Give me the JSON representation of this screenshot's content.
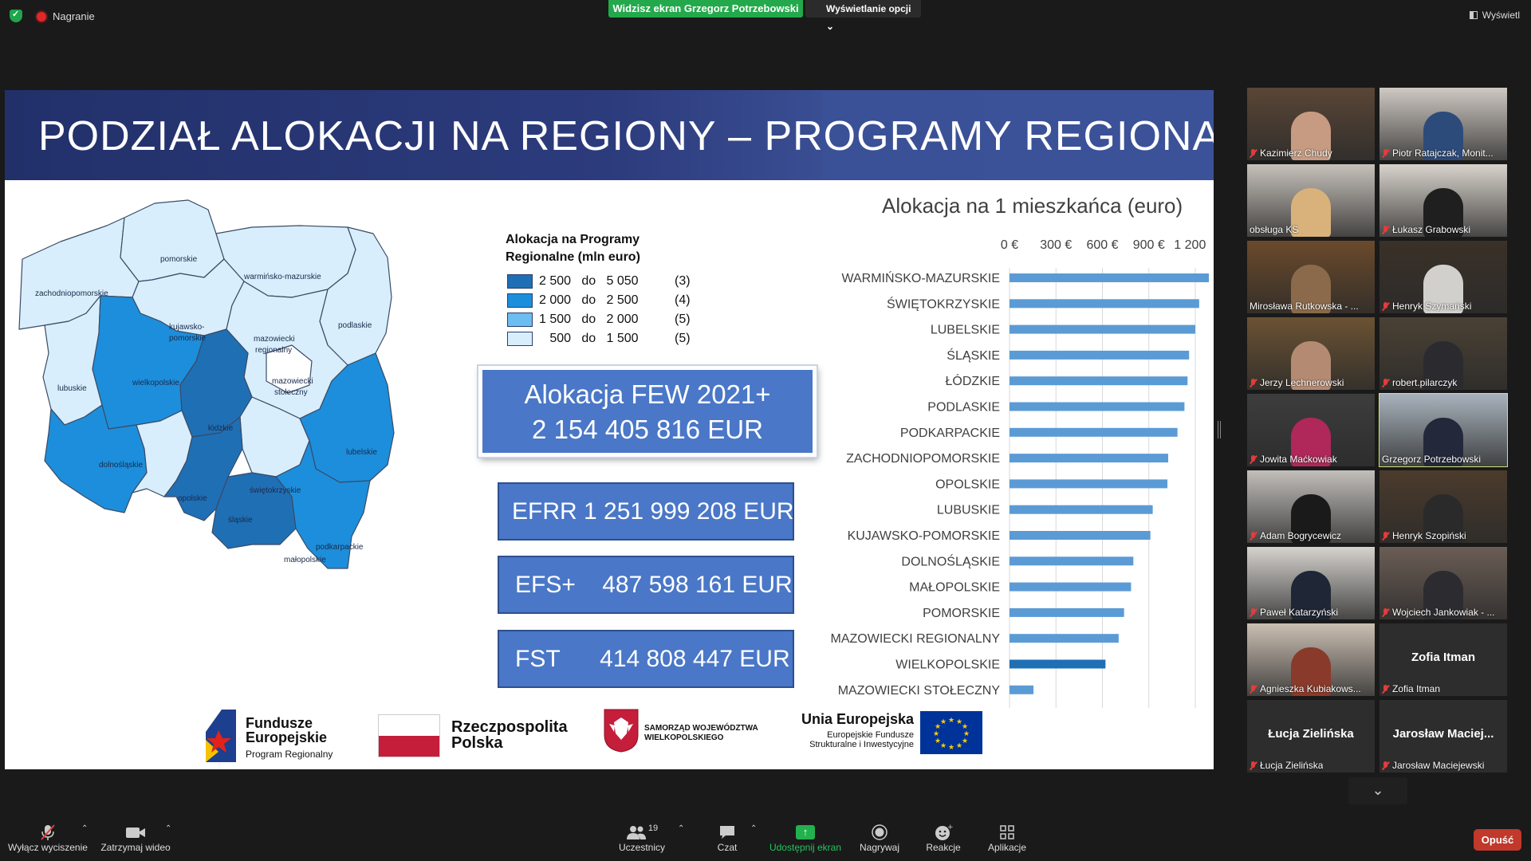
{
  "top": {
    "recording": "Nagranie",
    "share_banner": "Widzisz ekran Grzegorz Potrzebowski",
    "view_options": "Wyświetlanie opcji ⌄",
    "view_button": "Wyświetl"
  },
  "slide": {
    "title": "PODZIAŁ ALOKACJI NA REGIONY – PROGRAMY REGIONALNE",
    "legend_title_1": "Alokacja na Programy",
    "legend_title_2": "Regionalne (mln euro)",
    "legend": [
      {
        "text": "2 500   do   5 050",
        "count": "(3)",
        "color": "#1f6fb5"
      },
      {
        "text": "2 000   do   2 500",
        "count": "(4)",
        "color": "#1d8edb"
      },
      {
        "text": "1 500   do   2 000",
        "count": "(5)",
        "color": "#6dbdf0"
      },
      {
        "text": "   500   do   1 500",
        "count": "(5)",
        "color": "#d8eefc"
      }
    ],
    "regions": {
      "pomorskie": "pomorskie",
      "zachodniopomorskie": "zachodniopomorskie",
      "warminsko": "warmińsko-mazurskie",
      "podlaskie": "podlaskie",
      "kujawsko1": "kujawsko-",
      "kujawsko2": "pomorskie",
      "mazreg1": "mazowiecki",
      "mazreg2": "regionalny",
      "lubuskie": "lubuskie",
      "wielkopolskie": "wielkopolskie",
      "mazst1": "mazowiecki",
      "mazst2": "stołeczny",
      "lodzkie": "łódzkie",
      "lubelskie": "lubelskie",
      "dolnoslaskie": "dolnośląskie",
      "swietokrzyskie": "świętokrzyskie",
      "opolskie": "opolskie",
      "slaskie": "śląskie",
      "podkarpackie": "podkarpackie",
      "malopolskie": "małopolskie"
    },
    "few_line1": "Alokacja FEW 2021+",
    "few_line2": "2 154 405 816 EUR",
    "efrr": "EFRR 1 251 999 208 EUR",
    "efs": "EFS+    487 598 161 EUR",
    "fst": "FST      414 808 447 EUR",
    "logos": {
      "fe1": "Fundusze",
      "fe2": "Europejskie",
      "fe3": "Program Regionalny",
      "rp1": "Rzeczpospolita",
      "rp2": "Polska",
      "wlkp1": "SAMORZĄD WOJEWÓDZTWA",
      "wlkp2": "WIELKOPOLSKIEGO",
      "ue1": "Unia Europejska",
      "ue2": "Europejskie Fundusze",
      "ue3": "Strukturalne i Inwestycyjne"
    }
  },
  "chart_data": {
    "type": "bar",
    "orientation": "horizontal",
    "title": "Alokacja na 1 mieszkańca (euro)",
    "x_ticks": [
      "0 €",
      "300 €",
      "600 €",
      "900 €",
      "1 200 €"
    ],
    "xlim": [
      0,
      1200
    ],
    "grid": true,
    "categories": [
      "WARMIŃSKO-MAZURSKIE",
      "ŚWIĘTOKRZYSKIE",
      "LUBELSKIE",
      "ŚLĄSKIE",
      "ŁÓDZKIE",
      "PODLASKIE",
      "PODKARPACKIE",
      "ZACHODNIOPOMORSKIE",
      "OPOLSKIE",
      "LUBUSKIE",
      "KUJAWSKO-POMORSKIE",
      "DOLNOŚLĄSKIE",
      "MAŁOPOLSKIE",
      "POMORSKIE",
      "MAZOWIECKI REGIONALNY",
      "WIELKOPOLSKIE",
      "MAZOWIECKI STOŁECZNY"
    ],
    "values": [
      1300,
      1225,
      1200,
      1160,
      1150,
      1130,
      1085,
      1025,
      1020,
      925,
      910,
      800,
      785,
      740,
      705,
      620,
      155
    ],
    "bar_color": "#5b9bd5",
    "highlight_color": "#1f6fb5",
    "highlight_index": 15
  },
  "gallery": [
    {
      "name": "Kazimierz Chudy",
      "muted": true,
      "bg": "#5a4636",
      "skin": "#c79b82"
    },
    {
      "name": "Piotr Ratajczak, Monit...",
      "muted": true,
      "bg": "#cfc9c3",
      "skin": "#2d4b7a"
    },
    {
      "name": "obsługa KS",
      "muted": false,
      "bg": "#c7c1bb",
      "skin": "#d9b27b"
    },
    {
      "name": "Łukasz Grabowski",
      "muted": true,
      "bg": "#d9d3cc",
      "skin": "#1f1f1f"
    },
    {
      "name": "Mirosława Rutkowska - ...",
      "muted": false,
      "bg": "#6b4a2b",
      "skin": "#8a6a4a"
    },
    {
      "name": "Henryk Szymański",
      "muted": true,
      "bg": "#3a3128",
      "skin": "#d2d0cc"
    },
    {
      "name": "Jerzy Lechnerowski",
      "muted": true,
      "bg": "#6b5233",
      "skin": "#b48a72"
    },
    {
      "name": "robert.pilarczyk",
      "muted": true,
      "bg": "#4a4134",
      "skin": "#2b2b2f"
    },
    {
      "name": "Jowita Maćkowiak",
      "muted": true,
      "bg": "#3d3d3d",
      "skin": "#b0285a"
    },
    {
      "name": "Grzegorz Potrzebowski",
      "muted": false,
      "bg": "#a9b3bd",
      "skin": "#23283a"
    },
    {
      "name": "Adam Bogrycewicz",
      "muted": true,
      "bg": "#c2bfbb",
      "skin": "#1a1a1a"
    },
    {
      "name": "Henryk Szopiński",
      "muted": true,
      "bg": "#4b3b2c",
      "skin": "#2a2a2a"
    },
    {
      "name": "Paweł Katarzyński",
      "muted": true,
      "bg": "#d6d3ce",
      "skin": "#1f2635"
    },
    {
      "name": "Wojciech Jankowiak - ...",
      "muted": true,
      "bg": "#6b5d55",
      "skin": "#2c2c30"
    },
    {
      "name": "Agnieszka Kubiakows...",
      "muted": true,
      "bg": "#cbbfb3",
      "skin": "#8a3a2a"
    },
    {
      "name": "Zofia Itman",
      "muted": true,
      "video": false,
      "big": "Zofia Itman"
    },
    {
      "name": "Łucja Zielińska",
      "muted": true,
      "video": false,
      "big": "Łucja Zielińska"
    },
    {
      "name": "Jarosław Maciejewski",
      "muted": true,
      "video": false,
      "big": "Jarosław  Maciej..."
    }
  ],
  "toolbar": {
    "mute": "Wyłącz wyciszenie",
    "video": "Zatrzymaj wideo",
    "participants": "Uczestnicy",
    "participants_count": "19",
    "chat": "Czat",
    "share": "Udostępnij ekran",
    "record": "Nagrywaj",
    "reactions": "Reakcje",
    "apps": "Aplikacje",
    "leave": "Opuść"
  }
}
